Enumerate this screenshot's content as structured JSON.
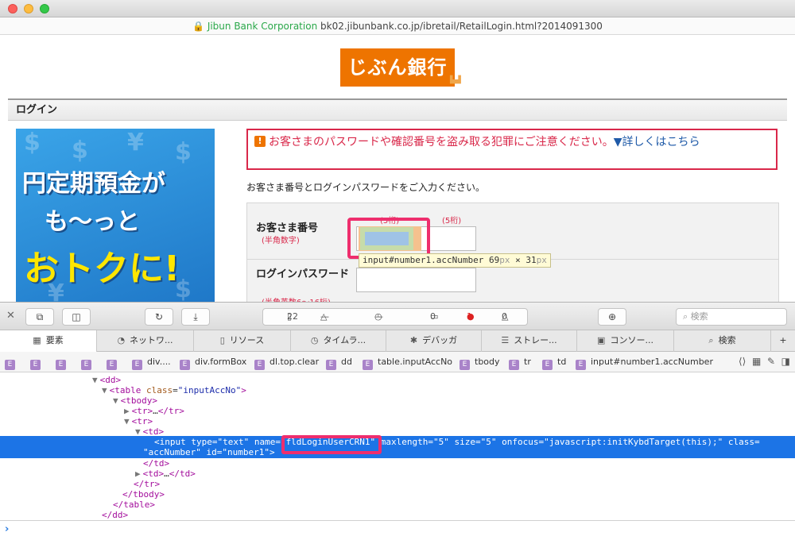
{
  "browser": {
    "org": "Jibun Bank Corporation",
    "url": "bk02.jibunbank.co.jp/ibretail/RetailLogin.html?2014091300"
  },
  "page": {
    "logo": "じぶん銀行",
    "login_header": "ログイン",
    "banner_lines": [
      "円定期預金が",
      "も〜っと",
      "おトクに!"
    ],
    "warning_text": "お客さまのパスワードや確認番号を盗み取る犯罪にご注意ください。",
    "warning_link": "▼詳しくはこちら",
    "instruction": "お客さま番号とログインパスワードをご入力ください。",
    "account_label": "お客さま番号",
    "account_sub": "(半角数字)",
    "digits1": "(5桁)",
    "digits2": "(5桁)",
    "tooltip_selector": "input#number1.accNumber",
    "tooltip_w": "69",
    "tooltip_px1": "px",
    "tooltip_x": " × ",
    "tooltip_h": "31",
    "tooltip_px2": "px",
    "password_label": "ログインパスワード",
    "password_sub": "(半角英数6〜16桁)"
  },
  "devtools": {
    "resource_count": "22",
    "load_dash1": "—",
    "load_dash2": "—",
    "log_count": "0",
    "error_count": "1",
    "warning_count": "0",
    "search_placeholder": "検索",
    "tabs": [
      "要素",
      "ネットワ...",
      "リソース",
      "タイムラ...",
      "デバッガ",
      "ストレー...",
      "コンソー...",
      "検索"
    ],
    "breadcrumbs": [
      "div....",
      "div.formBox",
      "dl.top.clear",
      "dd",
      "table.inputAccNo",
      "tbody",
      "tr",
      "td",
      "input#number1.accNumber"
    ],
    "dom_lines": {
      "l1": "dd",
      "l2_tag": "table",
      "l2_attr": "class",
      "l2_val": "\"inputAccNo\"",
      "l3": "tbody",
      "l4": "tr",
      "l4_ellipsis": "…",
      "l5": "tr",
      "l6": "td",
      "sel_line1": "<input type=\"text\" name=\"fldLoginUserCRN1\" maxlength=\"5\" size=\"5\" onfocus=\"javascript:initKybdTarget(this);\" class=",
      "sel_line2": "\"accNumber\" id=\"number1\">",
      "l9": "/td",
      "l10_tag": "td",
      "l11": "/tr",
      "l12": "/tbody",
      "l13": "/table",
      "l14": "/dd"
    }
  }
}
